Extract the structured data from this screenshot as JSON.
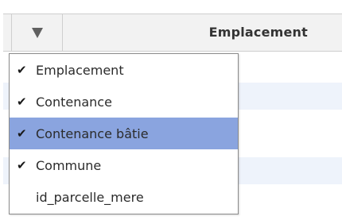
{
  "grid": {
    "column_title": "Emplacement"
  },
  "menu": {
    "items": [
      {
        "label": "Emplacement",
        "checked": true,
        "highlighted": false
      },
      {
        "label": "Contenance",
        "checked": true,
        "highlighted": false
      },
      {
        "label": "Contenance bâtie",
        "checked": true,
        "highlighted": true
      },
      {
        "label": "Commune",
        "checked": true,
        "highlighted": false
      },
      {
        "label": "id_parcelle_mere",
        "checked": false,
        "highlighted": false
      }
    ],
    "check_glyph": "✔"
  },
  "colors": {
    "highlight": "#8aa4df",
    "header_bg": "#f2f2f2",
    "row_alt": "#eef3fb"
  }
}
